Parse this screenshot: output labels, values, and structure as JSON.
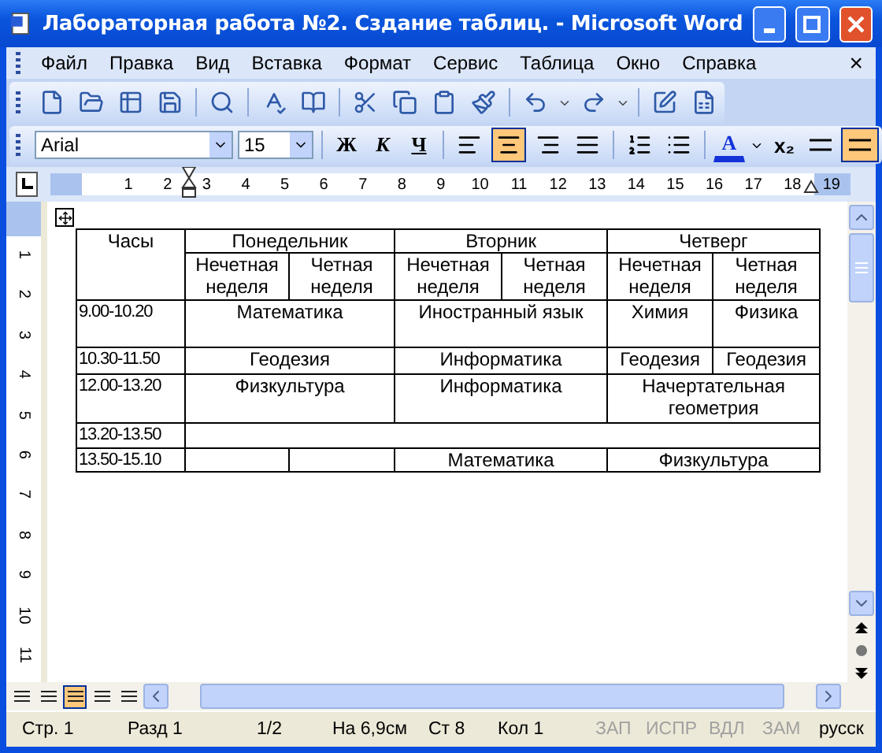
{
  "window": {
    "title": "Лабораторная работа №2. Сздание таблиц. - Microsoft Word"
  },
  "menu": [
    "Файл",
    "Правка",
    "Вид",
    "Вставка",
    "Формат",
    "Сервис",
    "Таблица",
    "Окно",
    "Справка"
  ],
  "menu_close": "×",
  "formatting": {
    "font": "Arial",
    "size": "15",
    "bold": "Ж",
    "italic": "К",
    "underline": "Ч",
    "align_buttons": [
      {
        "selected": false
      },
      {
        "selected": true
      },
      {
        "selected": false
      },
      {
        "selected": false
      }
    ],
    "font_color": "A",
    "subscript": "x₂",
    "border_button": {
      "selected": true
    }
  },
  "ruler": [
    "1",
    "2",
    "3",
    "4",
    "5",
    "6",
    "7",
    "8",
    "9",
    "10",
    "11",
    "12",
    "13",
    "14",
    "15",
    "16",
    "17",
    "18",
    "19"
  ],
  "vertical_ruler": [
    "1",
    "2",
    "3",
    "4",
    "5",
    "6",
    "7",
    "8",
    "9",
    "10",
    "11"
  ],
  "table": {
    "rows": [
      [
        {
          "text": "Часы",
          "rowspan": 2
        },
        {
          "text": "Понедельник",
          "colspan": 2
        },
        {
          "text": "Вторник",
          "colspan": 2
        },
        {
          "text": "Четверг",
          "colspan": 2
        }
      ],
      [
        {
          "text": "Нечетная неделя"
        },
        {
          "text": "Четная неделя"
        },
        {
          "text": "Нечетная неделя"
        },
        {
          "text": "Четная неделя"
        },
        {
          "text": "Нечетная неделя"
        },
        {
          "text": "Четная неделя"
        }
      ],
      [
        {
          "text": "9.00-10.20"
        },
        {
          "text": "Математика",
          "colspan": 2
        },
        {
          "text": "Иностранный язык",
          "colspan": 2
        },
        {
          "text": "Химия"
        },
        {
          "text": "Физика"
        }
      ],
      [
        {
          "text": "10.30-11.50"
        },
        {
          "text": "Геодезия",
          "colspan": 2
        },
        {
          "text": "Информатика",
          "colspan": 2
        },
        {
          "text": "Геодезия"
        },
        {
          "text": "Геодезия"
        }
      ],
      [
        {
          "text": "12.00-13.20"
        },
        {
          "text": "Физкультура",
          "colspan": 2
        },
        {
          "text": "Информатика",
          "colspan": 2
        },
        {
          "text": "Начертательная геометрия",
          "colspan": 2
        }
      ],
      [
        {
          "text": "13.20-13.50"
        },
        {
          "text": "",
          "colspan": 6
        }
      ],
      [
        {
          "text": "13.50-15.10"
        },
        {
          "text": ""
        },
        {
          "text": ""
        },
        {
          "text": "Математика",
          "colspan": 2
        },
        {
          "text": "Физкультура",
          "colspan": 2
        }
      ]
    ]
  },
  "view_buttons": [
    {
      "selected": false
    },
    {
      "selected": false
    },
    {
      "selected": true
    },
    {
      "selected": false
    },
    {
      "selected": false
    }
  ],
  "status_bar": [
    {
      "text": "Стр. 1",
      "disabled": false
    },
    {
      "text": "Разд 1",
      "disabled": false
    },
    {
      "text": "1/2",
      "disabled": false
    },
    {
      "text": "На 6,9см",
      "disabled": false
    },
    {
      "text": "Ст 8",
      "disabled": false
    },
    {
      "text": "Кол 1",
      "disabled": false
    },
    {
      "text": "ЗАП",
      "disabled": true
    },
    {
      "text": "ИСПР",
      "disabled": true
    },
    {
      "text": "ВДЛ",
      "disabled": true
    },
    {
      "text": "ЗАМ",
      "disabled": true
    },
    {
      "text": "русск",
      "disabled": false
    }
  ]
}
